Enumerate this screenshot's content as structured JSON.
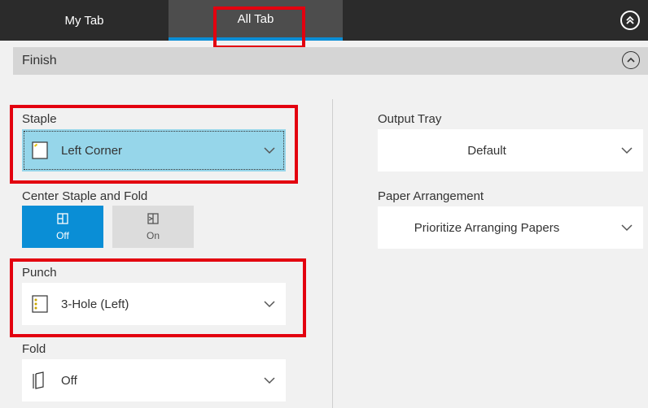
{
  "tabs": [
    {
      "label": "My Tab",
      "active": false
    },
    {
      "label": "All Tab",
      "active": true
    }
  ],
  "section": {
    "title": "Finish"
  },
  "staple": {
    "label": "Staple",
    "value": "Left Corner"
  },
  "center_staple": {
    "label": "Center Staple and Fold",
    "options": [
      "Off",
      "On"
    ],
    "selected": "Off"
  },
  "punch": {
    "label": "Punch",
    "value": "3-Hole (Left)"
  },
  "fold": {
    "label": "Fold",
    "value": "Off"
  },
  "output_tray": {
    "label": "Output Tray",
    "value": "Default"
  },
  "paper_arrangement": {
    "label": "Paper Arrangement",
    "value": "Prioritize Arranging Papers"
  },
  "colors": {
    "accent": "#0a8ed6",
    "highlight": "#e3000f",
    "selected_bg": "#96d6ea",
    "tabbar": "#2b2b2b"
  }
}
